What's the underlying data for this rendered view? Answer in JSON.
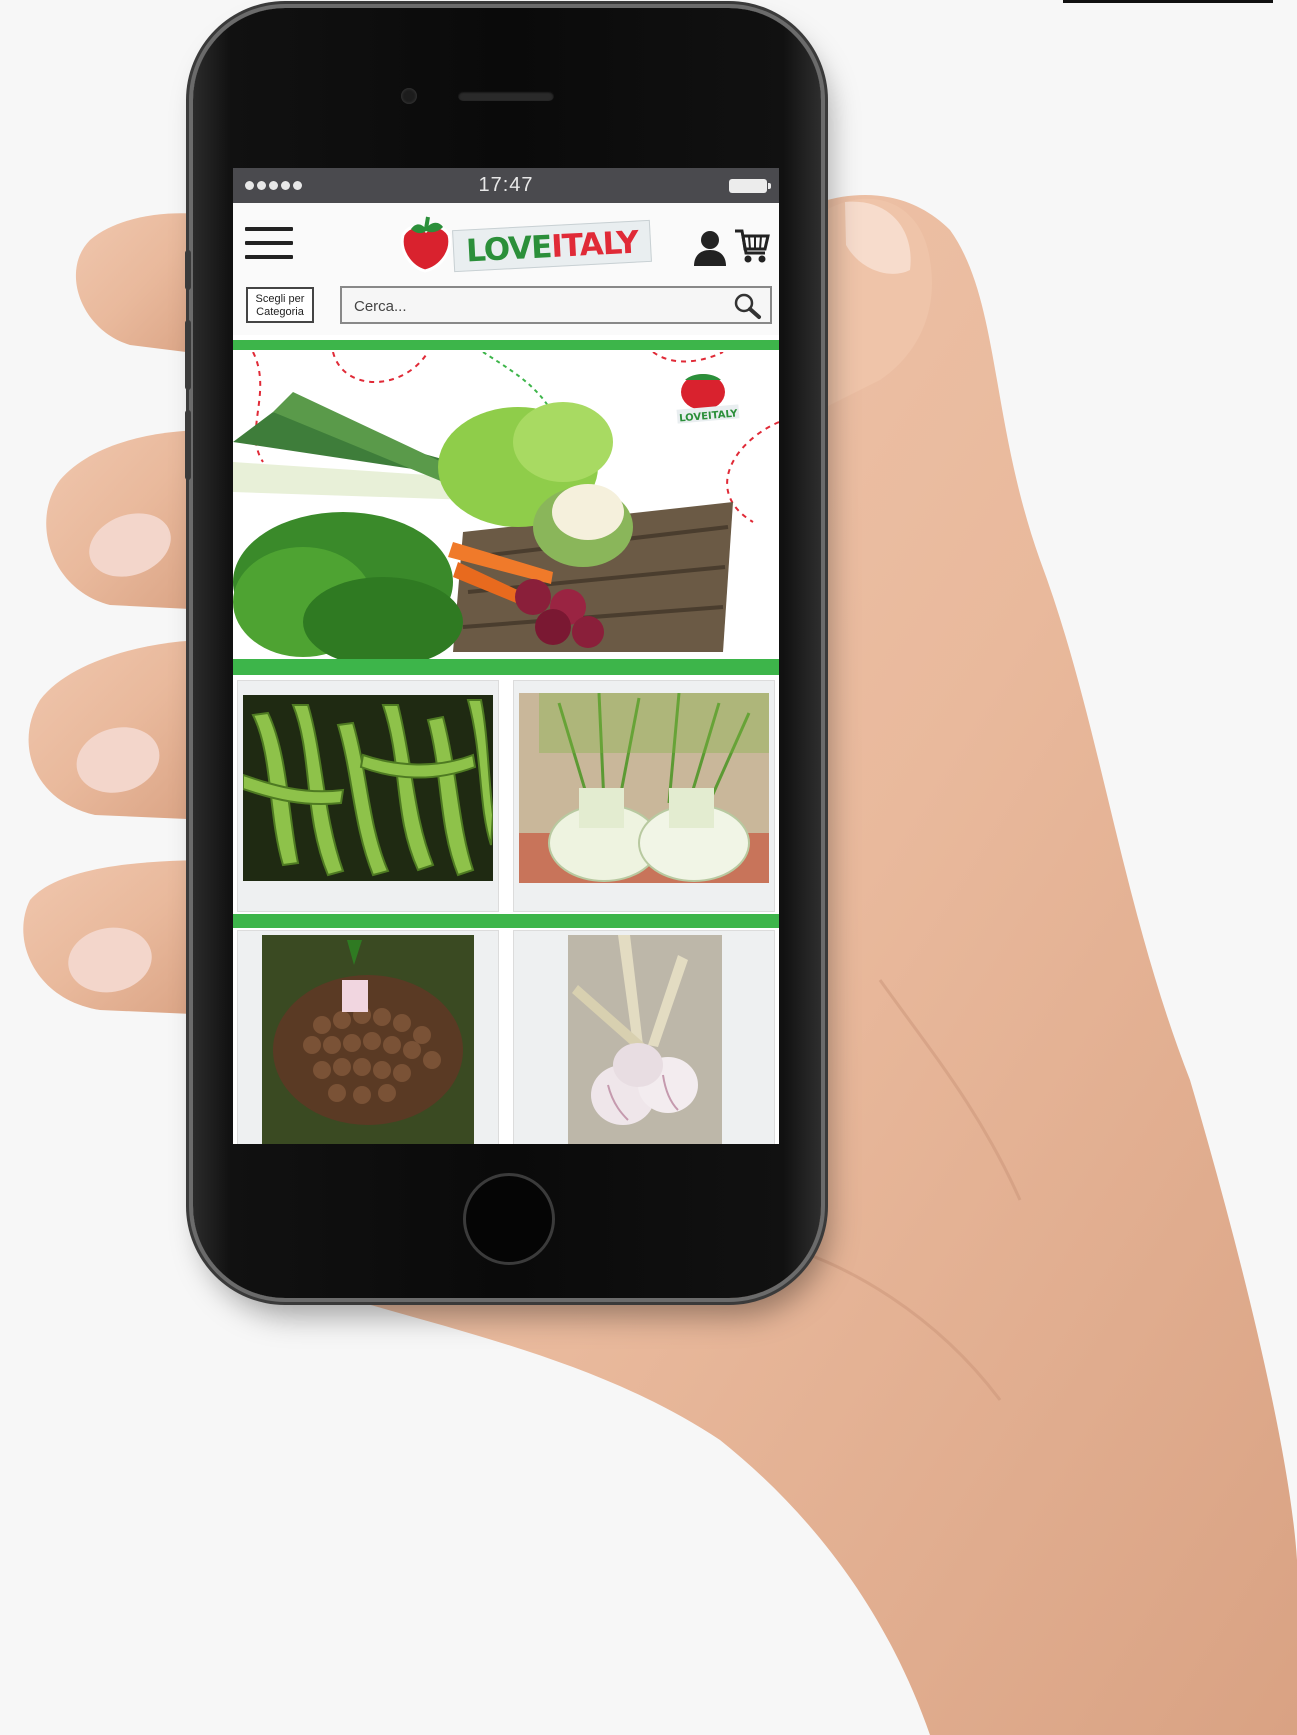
{
  "status_bar": {
    "time": "17:47"
  },
  "header": {
    "logo": {
      "part1": "LOVE",
      "part2": "ITALY"
    },
    "category_button": {
      "line1": "Scegli per",
      "line2": "Categoria"
    },
    "search": {
      "placeholder": "Cerca..."
    }
  },
  "hero": {
    "logo_small": "LOVEITALY"
  },
  "products": [
    {
      "name": "fave-beans"
    },
    {
      "name": "fennel"
    },
    {
      "name": "dried-figs"
    },
    {
      "name": "garlic"
    }
  ],
  "colors": {
    "brand_green": "#3db54a",
    "brand_red": "#e02a37",
    "status_bar": "#4a4a4e"
  },
  "icons": [
    "hamburger-menu-icon",
    "user-icon",
    "cart-icon",
    "search-icon",
    "tomato-logo-icon"
  ]
}
